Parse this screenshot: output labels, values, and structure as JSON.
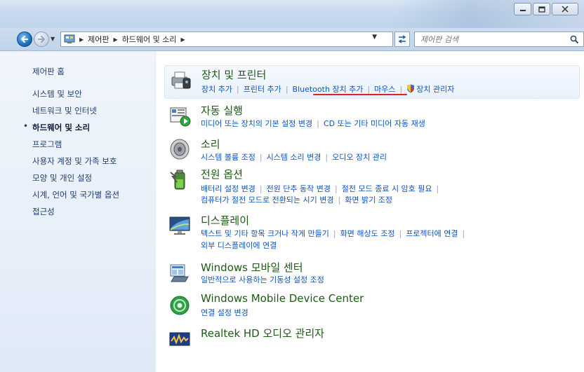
{
  "window": {
    "caption_buttons": [
      "minimize",
      "maximize",
      "close"
    ]
  },
  "address_bar": {
    "breadcrumbs": [
      "제어판",
      "하드웨어 및 소리"
    ],
    "search_placeholder": "제어판 검색"
  },
  "sidebar": {
    "items": [
      {
        "label": "제어판 홈",
        "current": false
      },
      {
        "label": "시스템 및 보안",
        "current": false
      },
      {
        "label": "네트워크 및 인터넷",
        "current": false
      },
      {
        "label": "하드웨어 및 소리",
        "current": true
      },
      {
        "label": "프로그램",
        "current": false
      },
      {
        "label": "사용자 계정 및 가족 보호",
        "current": false
      },
      {
        "label": "모양 및 개인 설정",
        "current": false
      },
      {
        "label": "시계, 언어 및 국가별 옵션",
        "current": false
      },
      {
        "label": "접근성",
        "current": false
      }
    ],
    "current_bullet": "•"
  },
  "categories": [
    {
      "title": "장치 및 프린터",
      "icon": "devices-printers-icon",
      "links": [
        "장치 추가",
        "프린터 추가",
        "Bluetooth 장치 추가",
        "마우스",
        "장치 관리자"
      ]
    },
    {
      "title": "자동 실행",
      "icon": "autoplay-icon",
      "links": [
        "미디어 또는 장치의 기본 설정 변경",
        "CD 또는 기타 미디어 자동 재생"
      ]
    },
    {
      "title": "소리",
      "icon": "speaker-icon",
      "links": [
        "시스템 볼륨 조정",
        "시스템 소리 변경",
        "오디오 장치 관리"
      ]
    },
    {
      "title": "전원 옵션",
      "icon": "power-battery-icon",
      "links": [
        "배터리 설정 변경",
        "전원 단추 동작 변경",
        "절전 모드 종료 시 암호 필요",
        "컴퓨터가 절전 모드로 전환되는 시기 변경",
        "화면 밝기 조정"
      ]
    },
    {
      "title": "디스플레이",
      "icon": "display-monitor-icon",
      "links": [
        "텍스트 및 기타 항목 크거나 작게 만들기",
        "화면 해상도 조정",
        "프로젝터에 연결",
        "외부 디스플레이에 연결"
      ]
    },
    {
      "title": "Windows 모바일 센터",
      "icon": "mobility-center-icon",
      "links": [
        "일반적으로 사용하는 기동성 설정 조정"
      ]
    },
    {
      "title": "Windows Mobile Device Center",
      "icon": "mobile-device-center-icon",
      "links": [
        "연결 설정 변경"
      ]
    },
    {
      "title": "Realtek HD 오디오 관리자",
      "icon": "realtek-audio-icon",
      "links": []
    }
  ],
  "colors": {
    "link": "#0d54c4",
    "category_title": "#1d5a15",
    "annotation_underline": "#e0212b"
  }
}
